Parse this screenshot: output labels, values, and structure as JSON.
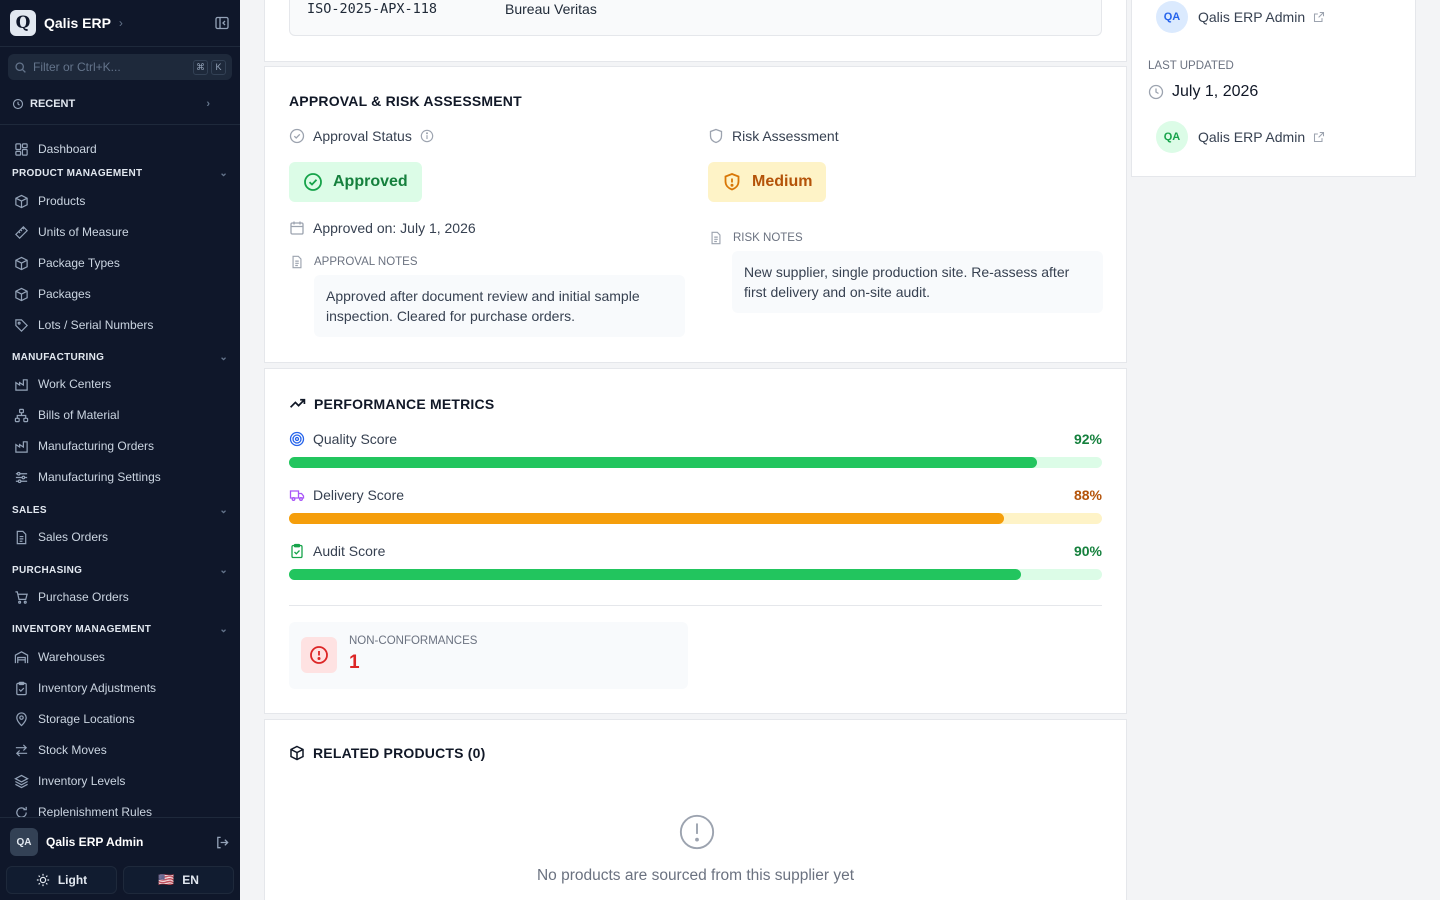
{
  "sidebar": {
    "brand": "Qalis ERP",
    "brand_letter": "Q",
    "filter_placeholder": "Filter or Ctrl+K...",
    "kbd1": "⌘",
    "kbd2": "K",
    "recent": "RECENT",
    "dashboard": "Dashboard",
    "sections": {
      "product": "PRODUCT MANAGEMENT",
      "manufacturing": "MANUFACTURING",
      "sales": "SALES",
      "purchasing": "PURCHASING",
      "inventory": "INVENTORY MANAGEMENT"
    },
    "items": {
      "products": "Products",
      "uom": "Units of Measure",
      "package_types": "Package Types",
      "packages": "Packages",
      "lots": "Lots / Serial Numbers",
      "work_centers": "Work Centers",
      "boms": "Bills of Material",
      "mos": "Manufacturing Orders",
      "mfg_settings": "Manufacturing Settings",
      "sales_orders": "Sales Orders",
      "purchase_orders": "Purchase Orders",
      "warehouses": "Warehouses",
      "inv_adjust": "Inventory Adjustments",
      "storage": "Storage Locations",
      "stock_moves": "Stock Moves",
      "inv_levels": "Inventory Levels",
      "replenish": "Replenishment Rules"
    },
    "user_initials": "QA",
    "user_name": "Qalis ERP Admin",
    "theme_label": "Light",
    "lang_label": "EN",
    "lang_flag": "🇺🇸"
  },
  "cert": {
    "number": "ISO-2025-APX-118",
    "issuer": "Bureau Veritas"
  },
  "approval": {
    "title": "APPROVAL & RISK ASSESSMENT",
    "status_label": "Approval Status",
    "status_value": "Approved",
    "approved_on": "Approved on: July 1, 2026",
    "notes_label": "APPROVAL NOTES",
    "notes": "Approved after document review and initial sample inspection. Cleared for purchase orders.",
    "risk_label": "Risk Assessment",
    "risk_value": "Medium",
    "risk_notes_label": "RISK NOTES",
    "risk_notes": "New supplier, single production site. Re-assess after first delivery and on-site audit."
  },
  "performance": {
    "title": "PERFORMANCE METRICS",
    "metrics": [
      {
        "label": "Quality Score",
        "value_text": "92%",
        "value": 0.92
      },
      {
        "label": "Delivery Score",
        "value_text": "88%",
        "value": 0.88
      },
      {
        "label": "Audit Score",
        "value_text": "90%",
        "value": 0.9
      }
    ],
    "ncr_label": "NON-CONFORMANCES",
    "ncr_value": "1"
  },
  "related": {
    "title": "RELATED PRODUCTS (0)",
    "empty": "No products are sourced from this supplier yet"
  },
  "meta": {
    "created_by_initials": "QA",
    "created_by": "Qalis ERP Admin",
    "last_updated_label": "LAST UPDATED",
    "last_updated": "July 1, 2026",
    "updated_by_initials": "QA",
    "updated_by": "Qalis ERP Admin"
  },
  "colors": {
    "green": "#16a34a",
    "green_bar": "#22c55e",
    "green_track": "#dcfce7",
    "orange": "#b45309",
    "orange_bar": "#f59e0b",
    "orange_track": "#fef3c7",
    "red": "#dc2626"
  }
}
